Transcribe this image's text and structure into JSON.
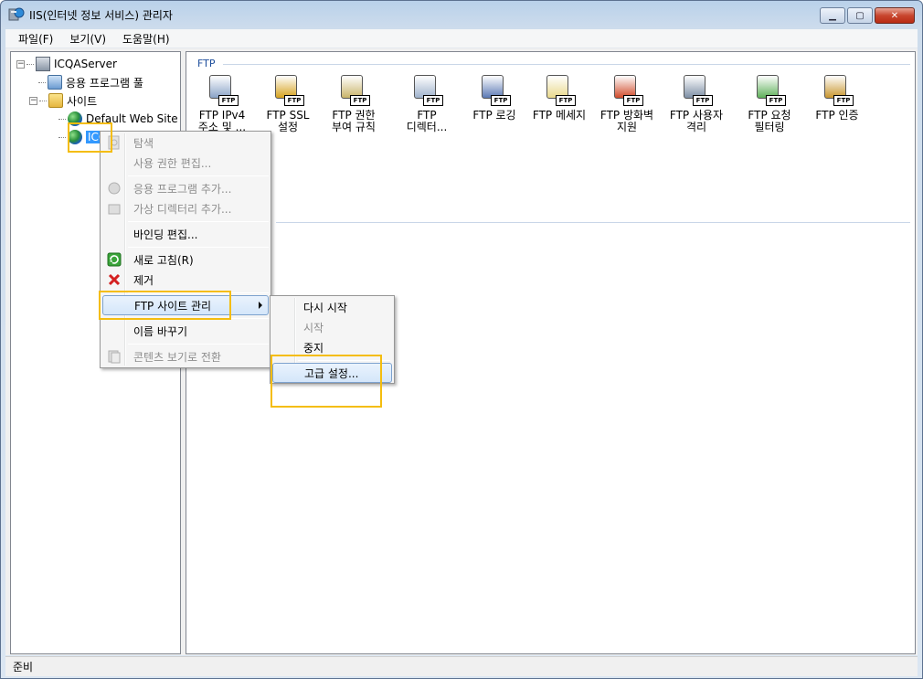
{
  "window": {
    "title": "IIS(인터넷 정보 서비스) 관리자"
  },
  "menubar": {
    "items": [
      "파일(F)",
      "보기(V)",
      "도움말(H)"
    ]
  },
  "tree": {
    "server": "ICQAServer",
    "app_pools": "응용 프로그램 풀",
    "sites": "사이트",
    "default_site": "Default Web Site",
    "selected_site": "ICQA"
  },
  "content": {
    "group": "FTP",
    "features": [
      {
        "l1": "FTP IPv4",
        "l2": "주소 및 ...",
        "icon": "network-computer-icon"
      },
      {
        "l1": "FTP SSL",
        "l2": "설정",
        "icon": "lock-icon"
      },
      {
        "l1": "FTP 권한",
        "l2": "부여 규칙",
        "icon": "key-icon"
      },
      {
        "l1": "FTP",
        "l2": "디렉터...",
        "icon": "directory-browse-icon"
      },
      {
        "l1": "FTP 로깅",
        "l2": "",
        "icon": "log-book-icon"
      },
      {
        "l1": "FTP 메세지",
        "l2": "",
        "icon": "message-doc-icon"
      },
      {
        "l1": "FTP 방화벽",
        "l2": "지원",
        "icon": "firewall-icon"
      },
      {
        "l1": "FTP 사용자",
        "l2": "격리",
        "icon": "user-isolation-icon"
      },
      {
        "l1": "FTP 요청",
        "l2": "필터링",
        "icon": "request-filter-icon"
      },
      {
        "l1": "FTP 인증",
        "l2": "",
        "icon": "authentication-icon"
      }
    ]
  },
  "context_menu": {
    "items": {
      "browse": "탐색",
      "edit_perms": "사용 권한 편집...",
      "add_app": "응용 프로그램 추가...",
      "add_vdir": "가상 디렉터리 추가...",
      "edit_bindings": "바인딩 편집...",
      "refresh": "새로 고침(R)",
      "remove": "제거",
      "manage_ftp": "FTP 사이트 관리",
      "rename": "이름 바꾸기",
      "switch_content": "콘텐츠 보기로 전환"
    }
  },
  "submenu": {
    "restart": "다시 시작",
    "start": "시작",
    "stop": "중지",
    "advanced": "고급 설정..."
  },
  "status": {
    "text": "준비"
  },
  "colors": {
    "highlight": "#f4bd0f",
    "selection": "#3399ff",
    "group_header": "#1e4e9c"
  }
}
